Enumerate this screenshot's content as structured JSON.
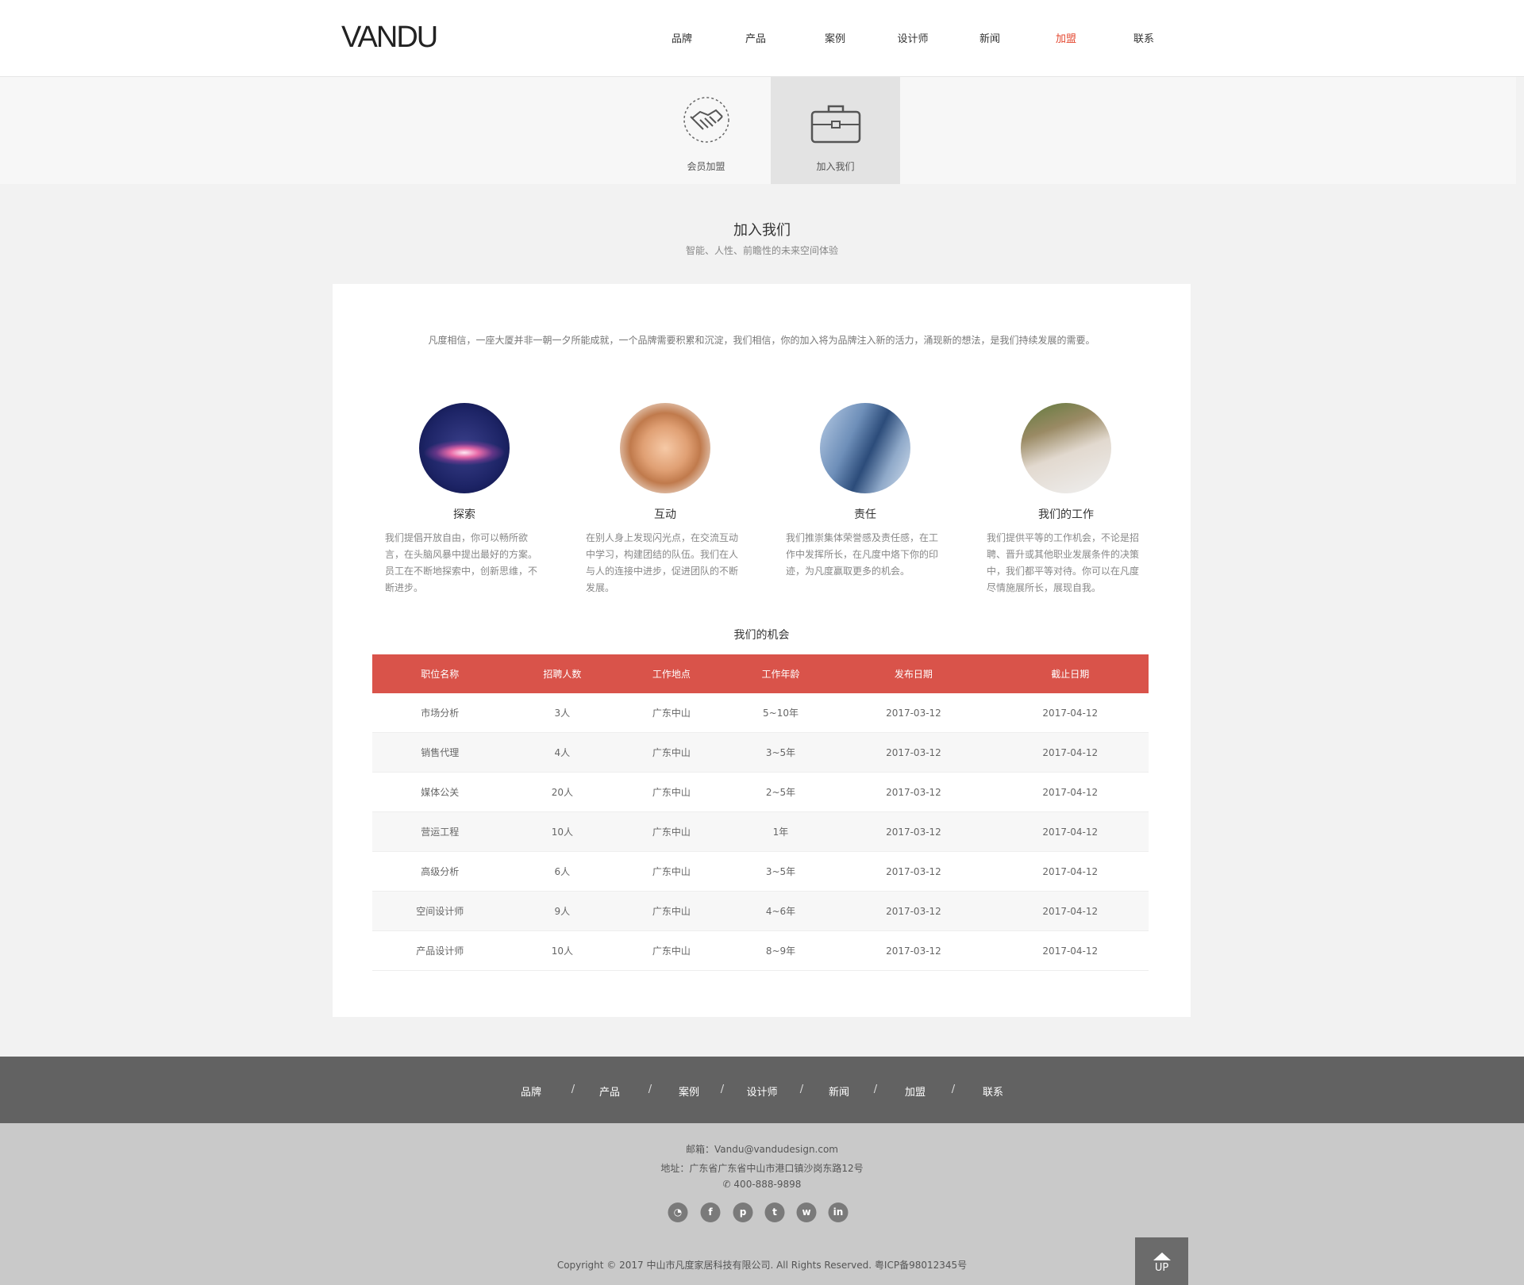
{
  "header": {
    "logo": "VANDU",
    "nav": [
      "品牌",
      "产品",
      "案例",
      "设计师",
      "新闻",
      "加盟",
      "联系"
    ],
    "active_nav": "加盟"
  },
  "subnav": {
    "tabs": [
      {
        "label": "会员加盟",
        "icon": "handshake-icon"
      },
      {
        "label": "加入我们",
        "icon": "briefcase-icon",
        "active": true
      }
    ]
  },
  "section": {
    "title": "加入我们",
    "subtitle": "智能、人性、前瞻性的未来空间体验"
  },
  "intro": "凡度相信，一座大厦并非一朝一夕所能成就，一个品牌需要积累和沉淀，我们相信，你的加入将为品牌注入新的活力，涌现新的想法，是我们持续发展的需要。",
  "features": [
    {
      "title": "探索",
      "desc": "我们提倡开放自由，你可以畅所欲言，在头脑风暴中提出最好的方案。员工在不断地探索中，创新思维，不断进步。",
      "image": "galaxy-image"
    },
    {
      "title": "互动",
      "desc": "在别人身上发现闪光点，在交流互动中学习，构建团结的队伍。我们在人与人的连接中进步，促进团队的不断发展。",
      "image": "stacked-hands-image"
    },
    {
      "title": "责任",
      "desc": "我们推崇集体荣誉感及责任感，在工作中发挥所长，在凡度中烙下你的印迹，为凡度赢取更多的机会。",
      "image": "skyscraper-image"
    },
    {
      "title": "我们的工作",
      "desc": "我们提供平等的工作机会，不论是招聘、晋升或其他职业发展条件的决策中，我们都平等对待。你可以在凡度尽情施展所长，展现自我。",
      "image": "sketching-hand-image"
    }
  ],
  "opportunities": {
    "title": "我们的机会",
    "columns": [
      "职位名称",
      "招聘人数",
      "工作地点",
      "工作年龄",
      "发布日期",
      "截止日期"
    ],
    "rows": [
      [
        "市场分析",
        "3人",
        "广东中山",
        "5~10年",
        "2017-03-12",
        "2017-04-12"
      ],
      [
        "销售代理",
        "4人",
        "广东中山",
        "3~5年",
        "2017-03-12",
        "2017-04-12"
      ],
      [
        "媒体公关",
        "20人",
        "广东中山",
        "2~5年",
        "2017-03-12",
        "2017-04-12"
      ],
      [
        "营运工程",
        "10人",
        "广东中山",
        "1年",
        "2017-03-12",
        "2017-04-12"
      ],
      [
        "高级分析",
        "6人",
        "广东中山",
        "3~5年",
        "2017-03-12",
        "2017-04-12"
      ],
      [
        "空间设计师",
        "9人",
        "广东中山",
        "4~6年",
        "2017-03-12",
        "2017-04-12"
      ],
      [
        "产品设计师",
        "10人",
        "广东中山",
        "8~9年",
        "2017-03-12",
        "2017-04-12"
      ]
    ]
  },
  "footer": {
    "nav": [
      "品牌",
      "产品",
      "案例",
      "设计师",
      "新闻",
      "加盟",
      "联系"
    ],
    "separator": "/",
    "email": "邮箱：Vandu@vandudesign.com",
    "address": "地址：广东省广东省中山市港口镇沙岗东路12号",
    "phone": "400-888-9898",
    "social": [
      {
        "name": "wechat-icon",
        "glyph": "◔"
      },
      {
        "name": "facebook-icon",
        "glyph": "f"
      },
      {
        "name": "pinterest-icon",
        "glyph": "p"
      },
      {
        "name": "twitter-icon",
        "glyph": "t"
      },
      {
        "name": "weibo-icon",
        "glyph": "w"
      },
      {
        "name": "linkedin-icon",
        "glyph": "in"
      }
    ],
    "copyright": "Copyright © 2017 中山市凡度家居科技有限公司. All Rights Reserved.    粤ICP备98012345号",
    "up_label": "UP"
  },
  "colors": {
    "accent": "#d9534a",
    "active_nav": "#e4472f",
    "footer_dark": "#626262",
    "footer_light": "#c9c9c9"
  }
}
